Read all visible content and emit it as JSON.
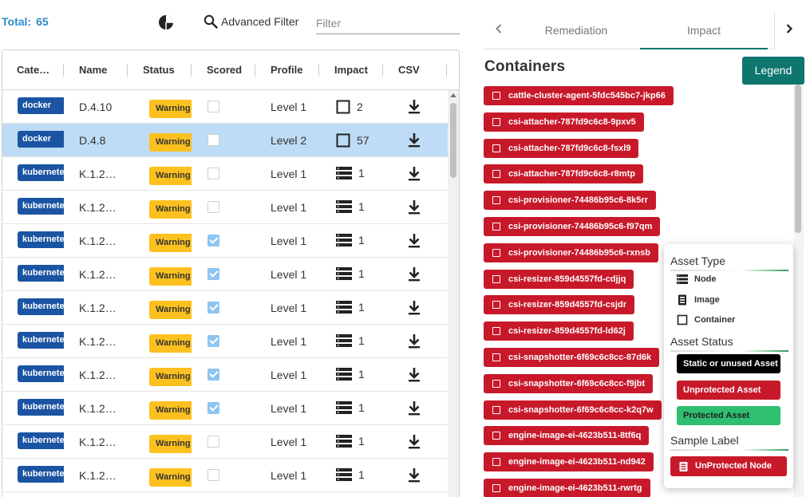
{
  "header": {
    "total_label": "Total:",
    "total_value": "65",
    "pie_icon": "pie-chart-icon",
    "advanced_filter_label": "Advanced Filter",
    "filter_placeholder": "Filter"
  },
  "table": {
    "columns": [
      "Cate…",
      "Name",
      "Status",
      "Scored",
      "Profile",
      "Impact",
      "CSV"
    ],
    "rows": [
      {
        "category": "docker",
        "name": "D.4.10",
        "status": "Warning",
        "scored": false,
        "profile": "Level 1",
        "impact_icon": "container-icon",
        "impact": "2",
        "selected": false
      },
      {
        "category": "docker",
        "name": "D.4.8",
        "status": "Warning",
        "scored": false,
        "profile": "Level 2",
        "impact_icon": "container-icon",
        "impact": "57",
        "selected": true
      },
      {
        "category": "kubernetes",
        "name": "K.1.2…",
        "status": "Warning",
        "scored": false,
        "profile": "Level 1",
        "impact_icon": "node-icon",
        "impact": "1",
        "selected": false
      },
      {
        "category": "kubernetes",
        "name": "K.1.2…",
        "status": "Warning",
        "scored": false,
        "profile": "Level 1",
        "impact_icon": "node-icon",
        "impact": "1",
        "selected": false
      },
      {
        "category": "kubernetes",
        "name": "K.1.2…",
        "status": "Warning",
        "scored": true,
        "profile": "Level 1",
        "impact_icon": "node-icon",
        "impact": "1",
        "selected": false
      },
      {
        "category": "kubernetes",
        "name": "K.1.2…",
        "status": "Warning",
        "scored": true,
        "profile": "Level 1",
        "impact_icon": "node-icon",
        "impact": "1",
        "selected": false
      },
      {
        "category": "kubernetes",
        "name": "K.1.2…",
        "status": "Warning",
        "scored": true,
        "profile": "Level 1",
        "impact_icon": "node-icon",
        "impact": "1",
        "selected": false
      },
      {
        "category": "kubernetes",
        "name": "K.1.2…",
        "status": "Warning",
        "scored": true,
        "profile": "Level 1",
        "impact_icon": "node-icon",
        "impact": "1",
        "selected": false
      },
      {
        "category": "kubernetes",
        "name": "K.1.2…",
        "status": "Warning",
        "scored": true,
        "profile": "Level 1",
        "impact_icon": "node-icon",
        "impact": "1",
        "selected": false
      },
      {
        "category": "kubernetes",
        "name": "K.1.2…",
        "status": "Warning",
        "scored": true,
        "profile": "Level 1",
        "impact_icon": "node-icon",
        "impact": "1",
        "selected": false
      },
      {
        "category": "kubernetes",
        "name": "K.1.2…",
        "status": "Warning",
        "scored": false,
        "profile": "Level 1",
        "impact_icon": "node-icon",
        "impact": "1",
        "selected": false
      },
      {
        "category": "kubernetes",
        "name": "K.1.2…",
        "status": "Warning",
        "scored": false,
        "profile": "Level 1",
        "impact_icon": "node-icon",
        "impact": "1",
        "selected": false
      }
    ]
  },
  "panel": {
    "tabs": [
      {
        "label": "Remediation",
        "active": false
      },
      {
        "label": "Impact",
        "active": true
      }
    ],
    "title": "Containers",
    "legend_button": "Legend",
    "containers": [
      "cattle-cluster-agent-5fdc545bc7-jkp66",
      "csi-attacher-787fd9c6c8-9pxv5",
      "csi-attacher-787fd9c6c8-fsxl9",
      "csi-attacher-787fd9c6c8-r8mtp",
      "csi-provisioner-74486b95c6-8k5rr",
      "csi-provisioner-74486b95c6-f97qm",
      "csi-provisioner-74486b95c6-rxnsb",
      "csi-resizer-859d4557fd-cdjjq",
      "csi-resizer-859d4557fd-csjdr",
      "csi-resizer-859d4557fd-ld62j",
      "csi-snapshotter-6f69c6c8cc-87d6k",
      "csi-snapshotter-6f69c6c8cc-f9jbt",
      "csi-snapshotter-6f69c6c8cc-k2q7w",
      "engine-image-ei-4623b511-8tf6q",
      "engine-image-ei-4623b511-nd942",
      "engine-image-ei-4623b511-rwrtg"
    ]
  },
  "legend": {
    "asset_type_title": "Asset Type",
    "asset_types": [
      {
        "label": "Node",
        "icon": "node-icon"
      },
      {
        "label": "Image",
        "icon": "image-icon"
      },
      {
        "label": "Container",
        "icon": "container-icon"
      }
    ],
    "asset_status_title": "Asset Status",
    "statuses": [
      {
        "label": "Static or unused Asset",
        "color": "#000000"
      },
      {
        "label": "Unprotected Asset",
        "color": "#c8192a"
      },
      {
        "label": "Protected Asset",
        "color": "#2fbf71"
      }
    ],
    "sample_title": "Sample Label",
    "sample_label": "UnProtected Node",
    "sample_icon": "image-icon"
  },
  "colors": {
    "accent": "#0f766e",
    "total": "#2e8bc9",
    "category_badge": "#1b54a3",
    "warning": "#fcc11f",
    "container_chip": "#c8192a",
    "selected_row": "#bedcf5"
  }
}
